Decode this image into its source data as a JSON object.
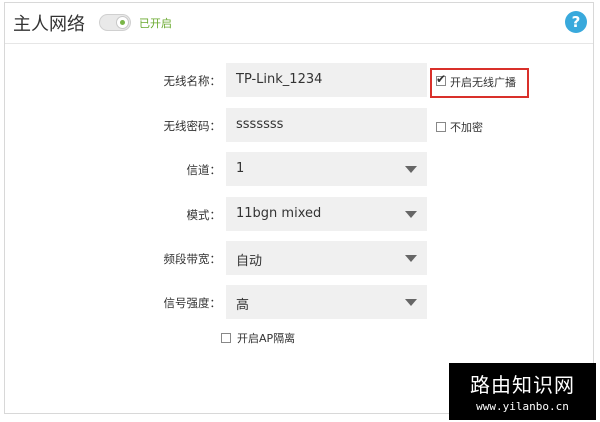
{
  "header": {
    "title": "主人网络",
    "status": "已开启",
    "help_icon": "?",
    "toggle_on": true
  },
  "form": {
    "ssid": {
      "label": "无线名称：",
      "value": "TP-Link_1234"
    },
    "broadcast": {
      "label": "开启无线广播",
      "checked": true
    },
    "password": {
      "label": "无线密码：",
      "value": "sssssss"
    },
    "no_encrypt": {
      "label": "不加密",
      "checked": false
    },
    "channel": {
      "label": "信道：",
      "value": "1"
    },
    "mode": {
      "label": "模式：",
      "value": "11bgn mixed"
    },
    "bandwidth": {
      "label": "频段带宽：",
      "value": "自动"
    },
    "signal": {
      "label": "信号强度：",
      "value": "高"
    },
    "ap_isolation": {
      "label": "开启AP隔离",
      "checked": false
    }
  },
  "watermark": {
    "title": "路由知识网",
    "url": "www.yilanbo.cn"
  },
  "colors": {
    "accent_green": "#6aaa2f",
    "help_blue": "#39a9dc",
    "highlight_red": "#d9302a"
  }
}
